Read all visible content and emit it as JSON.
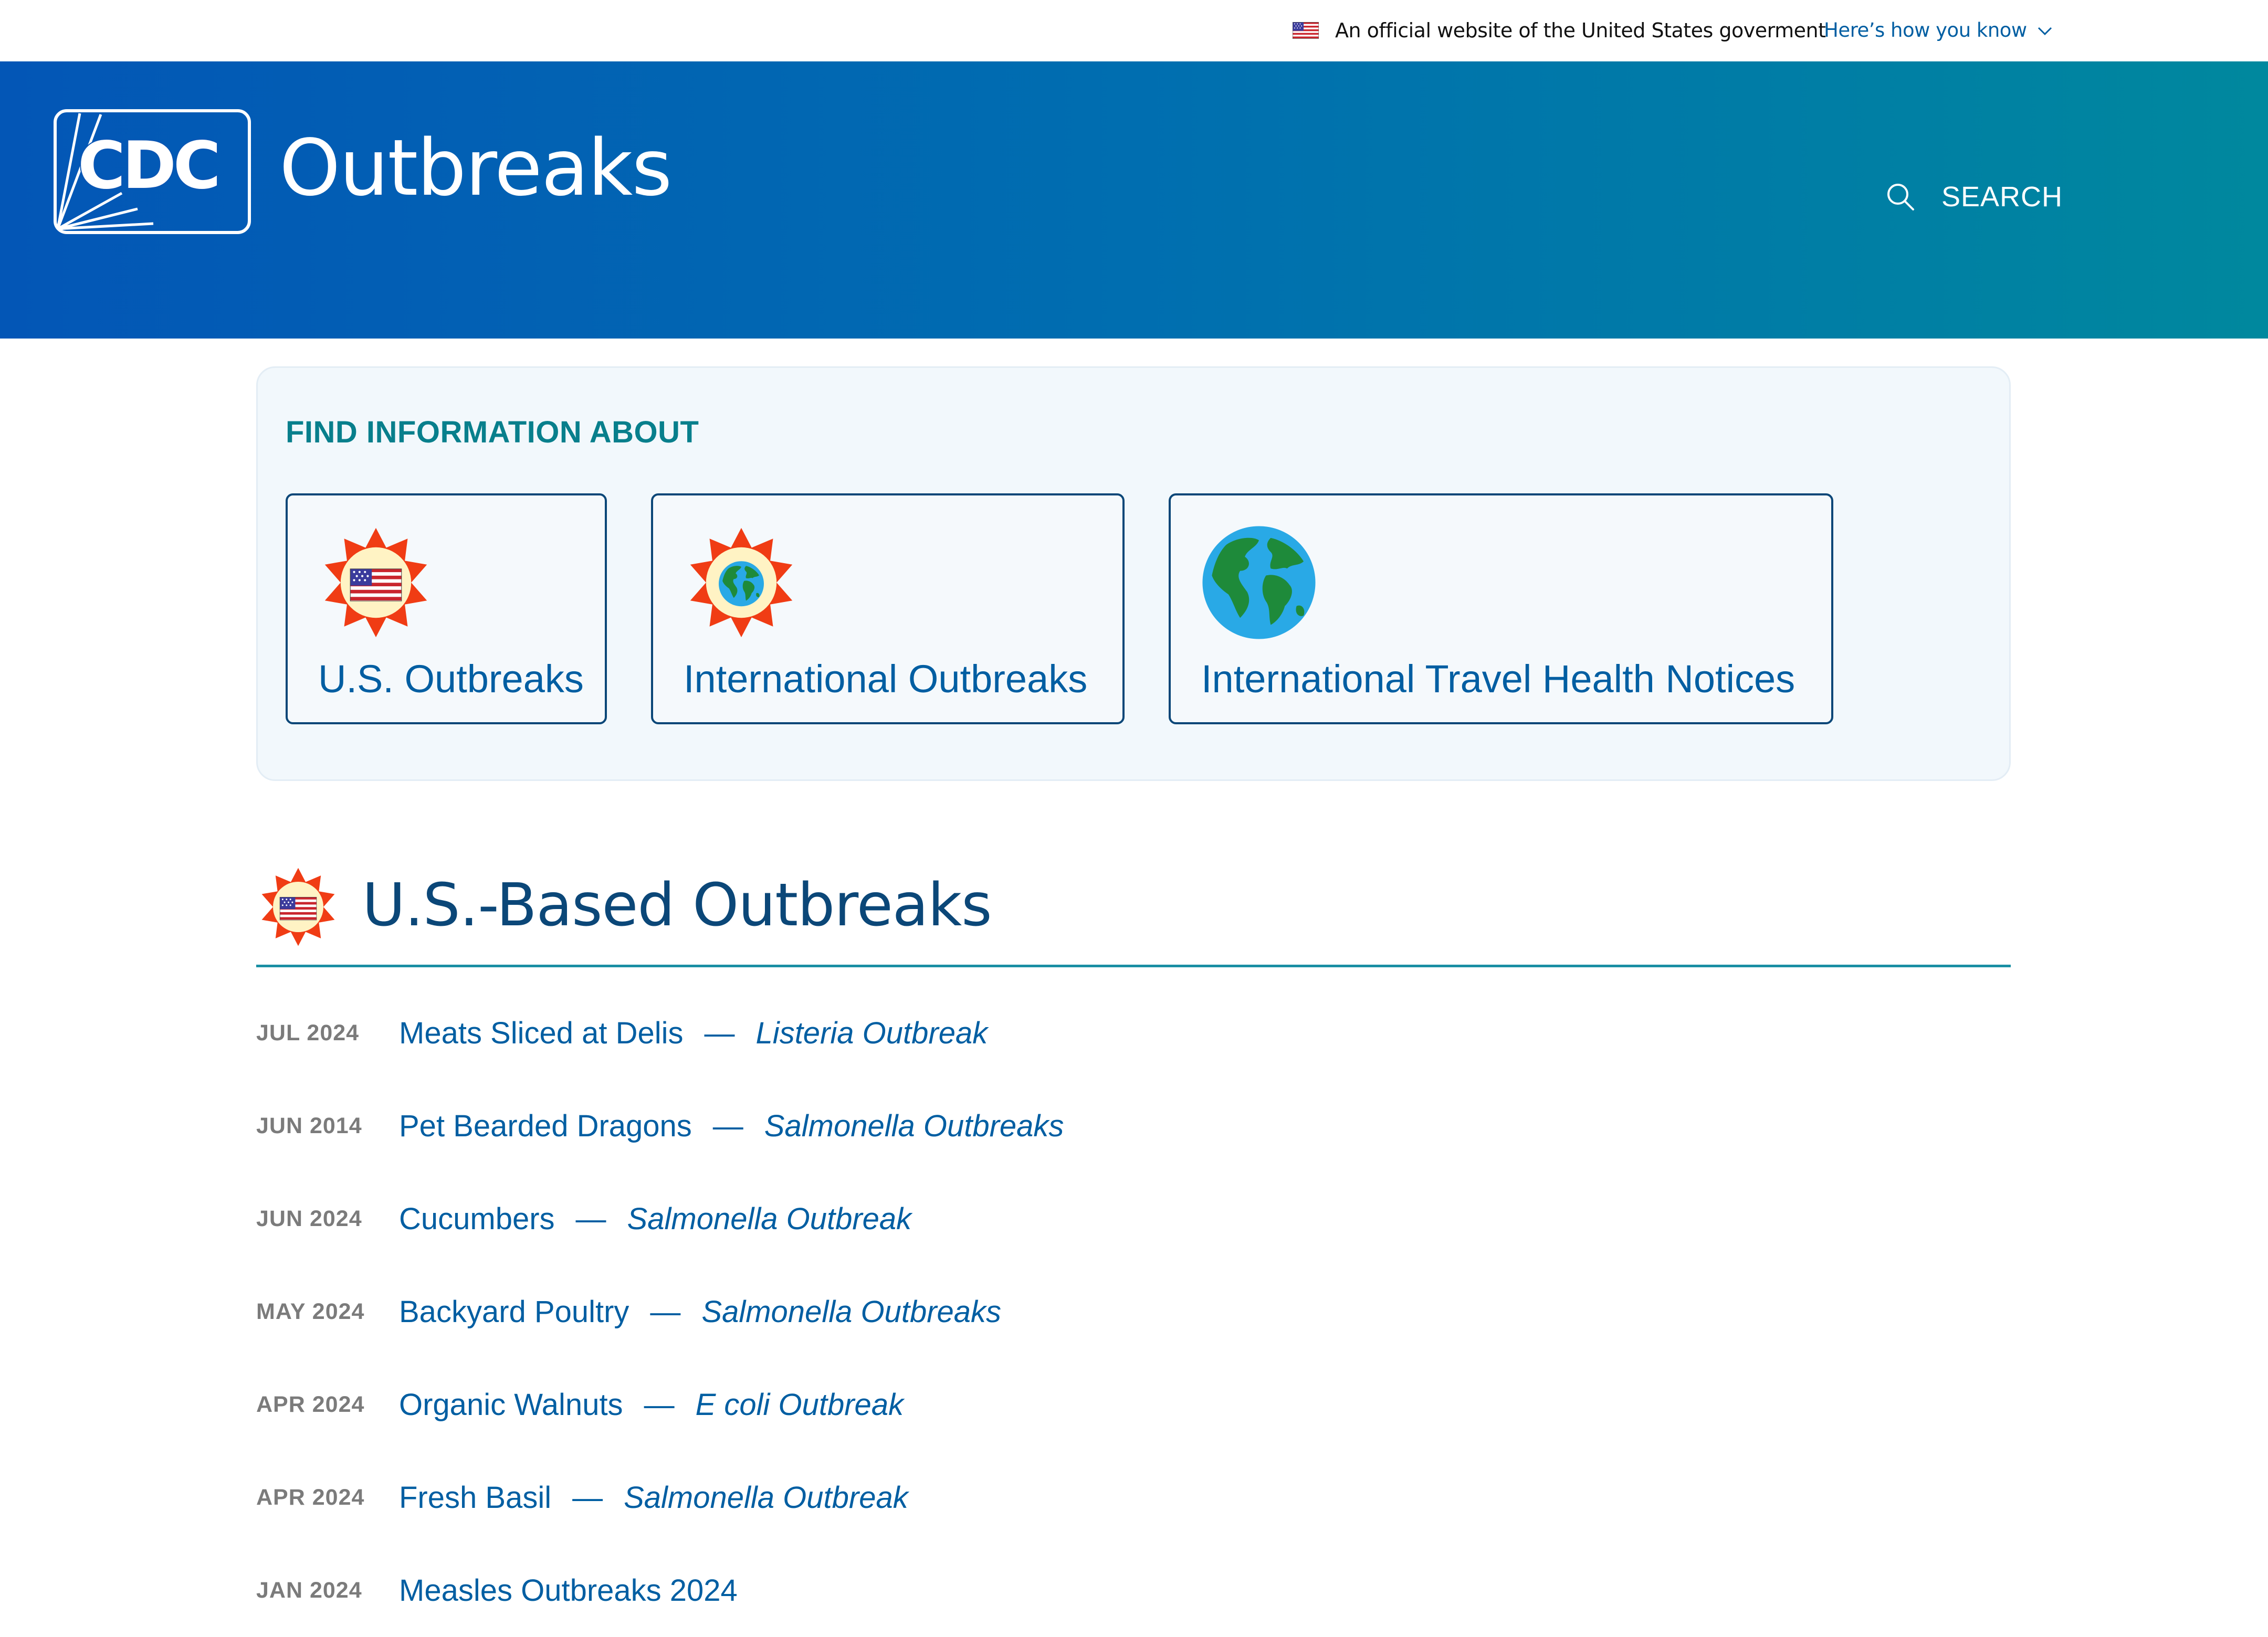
{
  "gov_banner": {
    "text": "An official website of the United States goverment",
    "link": "Here’s how you know"
  },
  "header": {
    "logo_text": "CDC",
    "title": "Outbreaks",
    "search_label": "SEARCH"
  },
  "find_info": {
    "heading": "FIND INFORMATION ABOUT",
    "cards": [
      {
        "label": "U.S. Outbreaks",
        "icon": "us-outbreak-badge-icon"
      },
      {
        "label": "International Outbreaks",
        "icon": "international-outbreak-badge-icon"
      },
      {
        "label": "International Travel Health Notices",
        "icon": "globe-icon"
      }
    ]
  },
  "section": {
    "title": "U.S.-Based Outbreaks",
    "icon": "us-outbreak-badge-icon"
  },
  "outbreaks": [
    {
      "date": "JUL 2024",
      "title": "Meats Sliced at Delis",
      "dash": "—",
      "subtitle": "Listeria Outbreak"
    },
    {
      "date": "JUN 2014",
      "title": "Pet Bearded Dragons",
      "dash": "—",
      "subtitle": "Salmonella Outbreaks"
    },
    {
      "date": "JUN 2024",
      "title": "Cucumbers",
      "dash": "—",
      "subtitle": "Salmonella Outbreak"
    },
    {
      "date": "MAY 2024",
      "title": "Backyard Poultry",
      "dash": "—",
      "subtitle": "Salmonella Outbreaks"
    },
    {
      "date": "APR 2024",
      "title": "Organic Walnuts",
      "dash": "—",
      "subtitle": "E coli Outbreak"
    },
    {
      "date": "APR 2024",
      "title": "Fresh Basil",
      "dash": "—",
      "subtitle": "Salmonella Outbreak"
    },
    {
      "date": "JAN 2024",
      "title": "Measles Outbreaks 2024",
      "dash": "",
      "subtitle": ""
    }
  ],
  "colors": {
    "primary_blue": "#005ea2",
    "heading_navy": "#0b4778",
    "teal": "#087f8c",
    "badge_red": "#f03c14",
    "badge_cream": "#fff3c4"
  }
}
